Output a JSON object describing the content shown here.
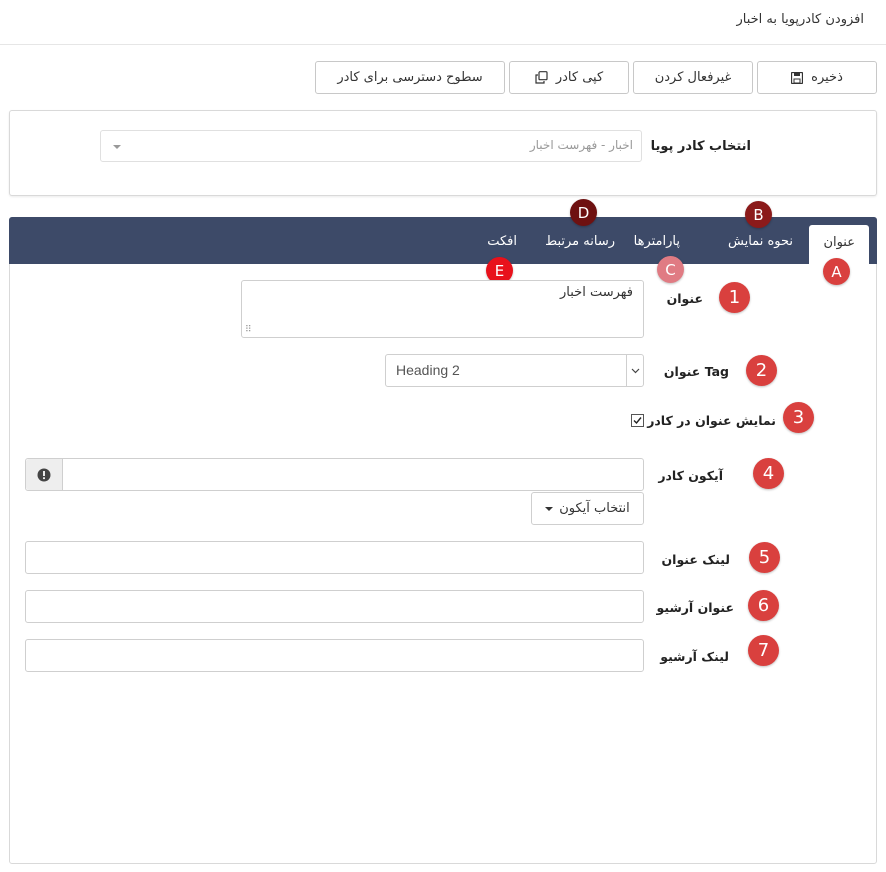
{
  "page": {
    "title": "افزودن کادرپویا به اخبار"
  },
  "toolbar": {
    "save_label": "ذخیره",
    "deactivate_label": "غیرفعال کردن",
    "copy_label": "کپی کادر",
    "access_label": "سطوح دسترسی برای کادر"
  },
  "frame_select": {
    "label": "انتخاب کادر پویا",
    "value": "اخبار - فهرست اخبار"
  },
  "tabs": [
    {
      "label": "عنوان",
      "active": true
    },
    {
      "label": "نحوه نمایش"
    },
    {
      "label": "پارامترها"
    },
    {
      "label": "رسانه مرتبط"
    },
    {
      "label": "افکت"
    }
  ],
  "tab_badges": [
    "A",
    "B",
    "C",
    "D",
    "E"
  ],
  "form": {
    "title": {
      "label": "عنوان",
      "value": "فهرست اخبار"
    },
    "title_tag": {
      "label": "Tag عنوان",
      "value": "Heading 2"
    },
    "show_title": {
      "label": "نمایش عنوان در کادر",
      "checked": true
    },
    "frame_icon": {
      "label": "آیکون کادر",
      "value": "",
      "pick_label": "انتخاب آیکون"
    },
    "title_link": {
      "label": "لینک عنوان",
      "value": ""
    },
    "archive_title": {
      "label": "عنوان آرشیو",
      "value": ""
    },
    "archive_link": {
      "label": "لینک آرشیو",
      "value": ""
    }
  },
  "field_badges": [
    "1",
    "2",
    "3",
    "4",
    "5",
    "6",
    "7"
  ],
  "colors": {
    "tabbar": "#3d4a68",
    "badge_red": "#d9403e",
    "badge_dark_red": "#8b1a1a",
    "badge_pink": "#e07b83",
    "badge_bright_red": "#e8111b"
  },
  "icons": {
    "save": "floppy-disk-icon",
    "copy": "copy-icon",
    "dropdown": "caret-down-icon",
    "alert": "exclamation-circle-icon",
    "checkbox": "checkmark-icon"
  }
}
